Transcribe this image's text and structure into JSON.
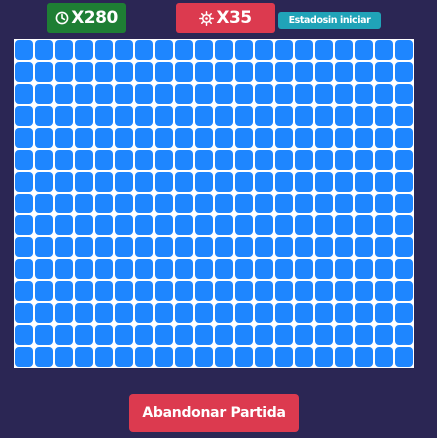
{
  "header": {
    "timer_label": "X280",
    "timer_icon": "clock-icon",
    "timer_color": "#1e7e34",
    "mines_label": "X35",
    "mines_icon": "mine-icon",
    "mines_color": "#dc3a4f",
    "status_label": "Estadosin iniciar",
    "status_color": "#20a3b8"
  },
  "board": {
    "columns": 20,
    "rows": 15,
    "cell_state": "unrevealed",
    "cell_color": "#1e86ff"
  },
  "actions": {
    "abandon_label": "Abandonar Partida"
  }
}
